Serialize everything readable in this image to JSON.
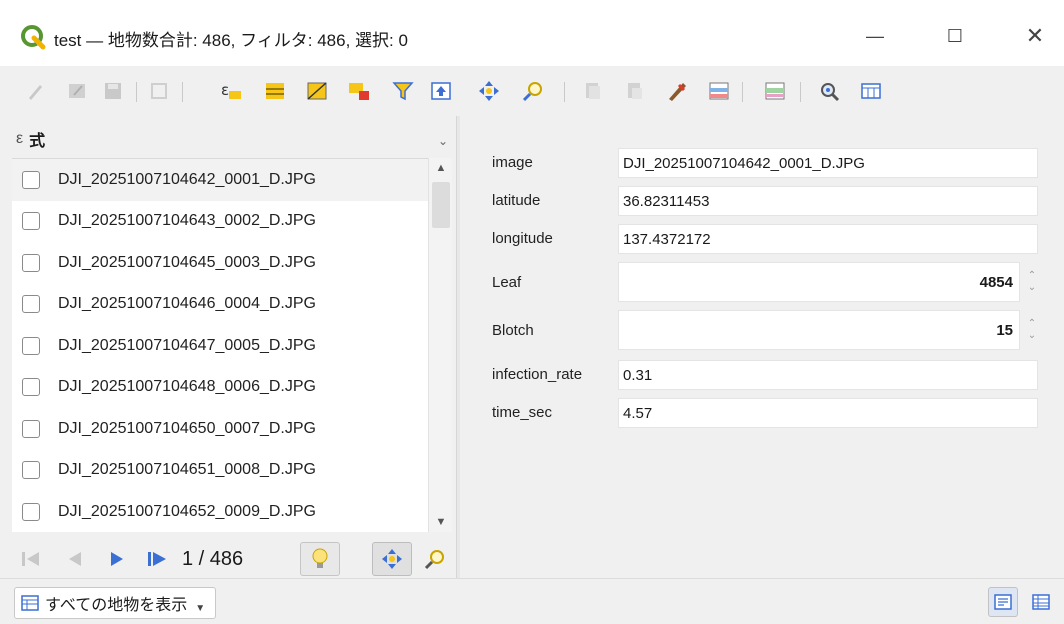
{
  "window": {
    "title": "test — 地物数合計: 486, フィルタ: 486, 選択: 0",
    "minimize": "—",
    "maximize": "☐",
    "close": "✕"
  },
  "toolbar": {
    "icons": [
      "edit-pencil-icon",
      "multi-edit-icon",
      "save-icon",
      "reload-icon",
      "expression-select-icon",
      "select-all-icon",
      "invert-selection-icon",
      "deselect-icon",
      "filter-icon",
      "move-selection-to-top-icon",
      "pan-to-selected-icon",
      "zoom-to-selected-icon",
      "copy-icon",
      "paste-icon",
      "field-calculator-icon",
      "conditional-format-icon",
      "actions-icon",
      "dock-icon",
      "organize-columns-icon"
    ]
  },
  "expression_bar": {
    "icon": "ε",
    "label": "式"
  },
  "features": [
    "DJI_20251007104642_0001_D.JPG",
    "DJI_20251007104643_0002_D.JPG",
    "DJI_20251007104645_0003_D.JPG",
    "DJI_20251007104646_0004_D.JPG",
    "DJI_20251007104647_0005_D.JPG",
    "DJI_20251007104648_0006_D.JPG",
    "DJI_20251007104650_0007_D.JPG",
    "DJI_20251007104651_0008_D.JPG",
    "DJI_20251007104652_0009_D.JPG"
  ],
  "navigation": {
    "page_info": "1 / 486"
  },
  "form": {
    "fields": [
      {
        "label": "image",
        "value": "DJI_20251007104642_0001_D.JPG",
        "type": "text"
      },
      {
        "label": "latitude",
        "value": "36.82311453",
        "type": "text"
      },
      {
        "label": "longitude",
        "value": "137.4372172",
        "type": "text"
      },
      {
        "label": "Leaf",
        "value": "4854",
        "type": "spin"
      },
      {
        "label": "Blotch",
        "value": "15",
        "type": "spin"
      },
      {
        "label": "infection_rate",
        "value": "0.31",
        "type": "text"
      },
      {
        "label": "time_sec",
        "value": "4.57",
        "type": "text"
      }
    ]
  },
  "statusbar": {
    "filter_label": "すべての地物を表示"
  },
  "colors": {
    "accent_yellow": "#f5c518",
    "accent_blue": "#3b6fd4",
    "qgis_green": "#589632"
  }
}
